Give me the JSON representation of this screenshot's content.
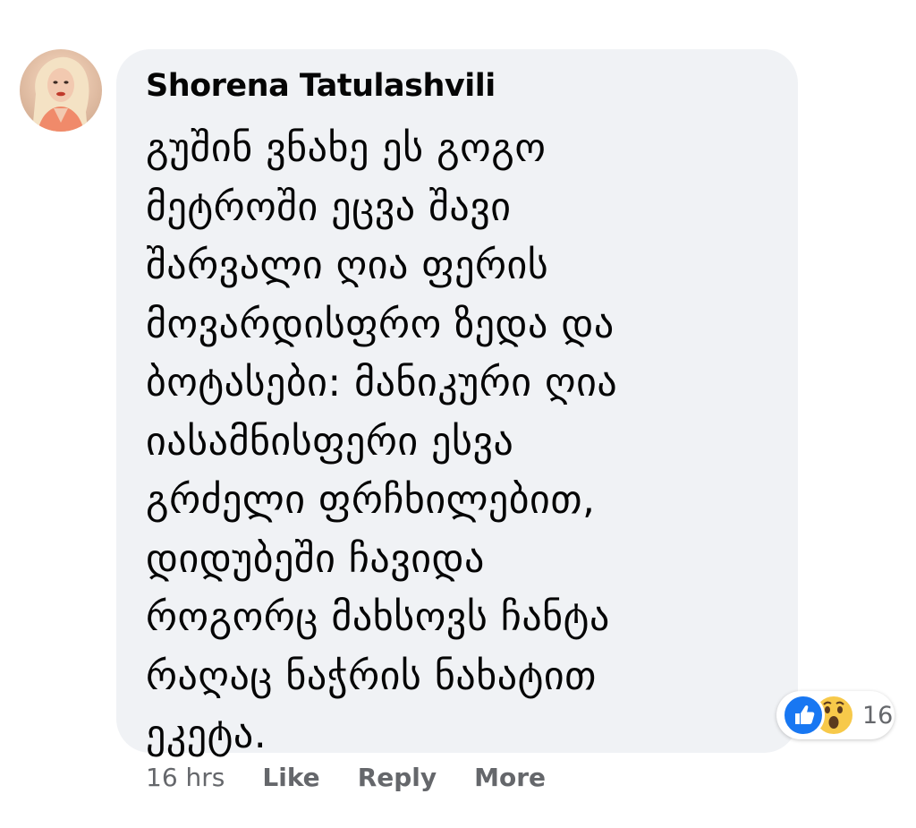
{
  "comment": {
    "author": "Shorena Tatulashvili",
    "text": "გუშინ ვნახე ეს გოგო\nმეტროში ეცვა შავი\nშარვალი ღია ფერის\nმოვარდისფრო ზედა და\nბოტასები: მანიკური ღია\nიასამნისფერი ესვა\nგრძელი ფრჩხილებით,\nდიდუბეში ჩავიდა\nროგორც მახსოვს ჩანტა\nრაღაც ნაჭრის ნახატით\nეკეტა.",
    "reactions": {
      "icons": [
        "like-icon",
        "wow-icon"
      ],
      "count": "16"
    },
    "time": "16 hrs",
    "actions": {
      "like": "Like",
      "reply": "Reply",
      "more": "More"
    }
  },
  "colors": {
    "bubble": "#f0f2f5",
    "secondary_text": "#65676b",
    "like_blue": "#1877f2",
    "wow_yellow": "#f7c94a"
  }
}
